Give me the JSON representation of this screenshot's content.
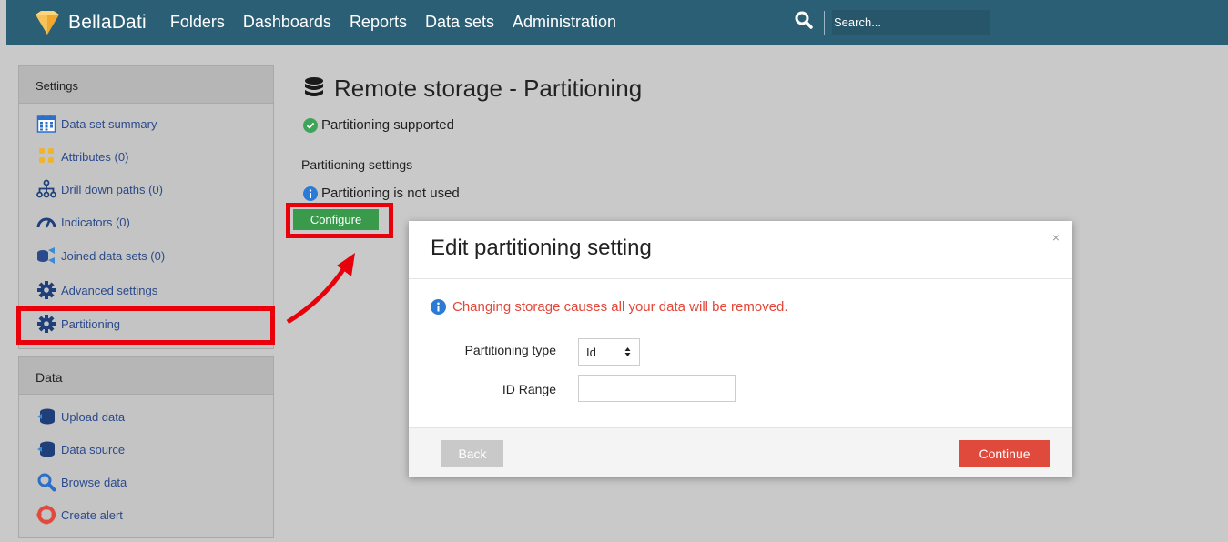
{
  "topbar": {
    "brand": "BellaDati",
    "nav": [
      "Folders",
      "Dashboards",
      "Reports",
      "Data sets",
      "Administration"
    ],
    "search_placeholder": "Search..."
  },
  "sidebar": {
    "settings_header": "Settings",
    "settings_items": [
      {
        "label": "Data set summary",
        "icon": "calendar-grid-icon"
      },
      {
        "label": "Attributes (0)",
        "icon": "dots-grid-icon"
      },
      {
        "label": "Drill down paths (0)",
        "icon": "hierarchy-icon"
      },
      {
        "label": "Indicators (0)",
        "icon": "gauge-icon"
      },
      {
        "label": "Joined data sets (0)",
        "icon": "join-icon"
      },
      {
        "label": "Advanced settings",
        "icon": "gear-icon"
      },
      {
        "label": "Partitioning",
        "icon": "gear-icon"
      }
    ],
    "data_header": "Data",
    "data_items": [
      {
        "label": "Upload data",
        "icon": "database-upload-icon"
      },
      {
        "label": "Data source",
        "icon": "database-source-icon"
      },
      {
        "label": "Browse data",
        "icon": "search-icon"
      },
      {
        "label": "Create alert",
        "icon": "alert-icon"
      }
    ]
  },
  "main": {
    "title": "Remote storage - Partitioning",
    "supported_status": "Partitioning supported",
    "settings_label": "Partitioning settings",
    "not_used_status": "Partitioning is not used",
    "configure_label": "Configure"
  },
  "modal": {
    "title": "Edit partitioning setting",
    "close_label": "×",
    "warning": "Changing storage causes all your data will be removed.",
    "type_label": "Partitioning type",
    "type_value": "Id",
    "range_label": "ID Range",
    "range_value": "",
    "back_label": "Back",
    "continue_label": "Continue"
  },
  "colors": {
    "navbar": "#2b5f75",
    "link": "#2b4a8b",
    "highlight": "#e8000b",
    "configure": "#3a9a4c",
    "continue": "#e04a3c",
    "warning": "#e44638"
  }
}
